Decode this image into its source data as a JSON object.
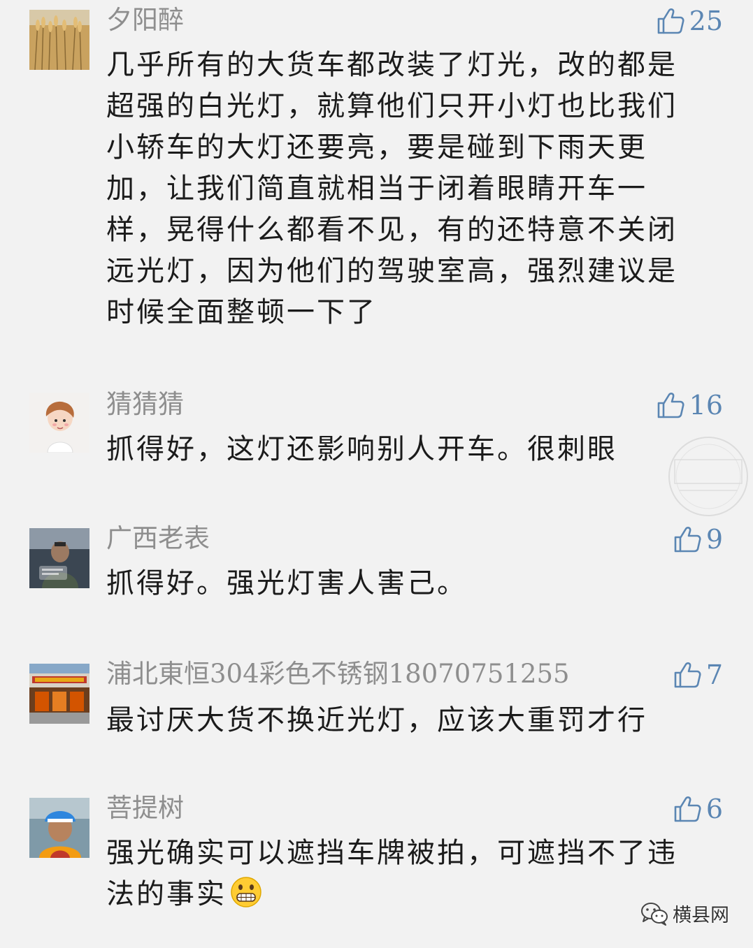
{
  "comments": [
    {
      "username": "夕阳醉",
      "likes": "25",
      "avatar_icon": "wheat-field-avatar",
      "text": "几乎所有的大货车都改装了灯光，改的都是超强的白光灯，就算他们只开小灯也比我们小轿车的大灯还要亮，要是碰到下雨天更加，让我们简直就相当于闭着眼睛开车一样，晃得什么都看不见，有的还特意不关闭远光灯，因为他们的驾驶室高，强烈建议是时候全面整顿一下了"
    },
    {
      "username": "猜猜猜",
      "likes": "16",
      "avatar_icon": "cartoon-child-avatar",
      "text": "抓得好，这灯还影响别人开车。很刺眼"
    },
    {
      "username": "广西老表",
      "likes": "9",
      "avatar_icon": "person-in-car-avatar",
      "text": "抓得好。强光灯害人害己。"
    },
    {
      "username": "浦北東恒304彩色不锈钢18070751255",
      "likes": "7",
      "avatar_icon": "storefront-avatar",
      "text": "最讨厌大货不换近光灯，应该大重罚才行"
    },
    {
      "username": "菩提树",
      "likes": "6",
      "avatar_icon": "cyclist-helmet-avatar",
      "text": "强光确实可以遮挡车牌被拍，可遮挡不了违法的事实",
      "emoji": "grinning-face-emoji"
    }
  ],
  "watermark": {
    "stamp_text": "横县网"
  },
  "brand": {
    "icon": "wechat-icon",
    "name": "横县网"
  },
  "colors": {
    "background": "#f2f2f2",
    "username": "#8e8e8e",
    "like": "#5b86b3",
    "text": "#1b1b1b"
  }
}
